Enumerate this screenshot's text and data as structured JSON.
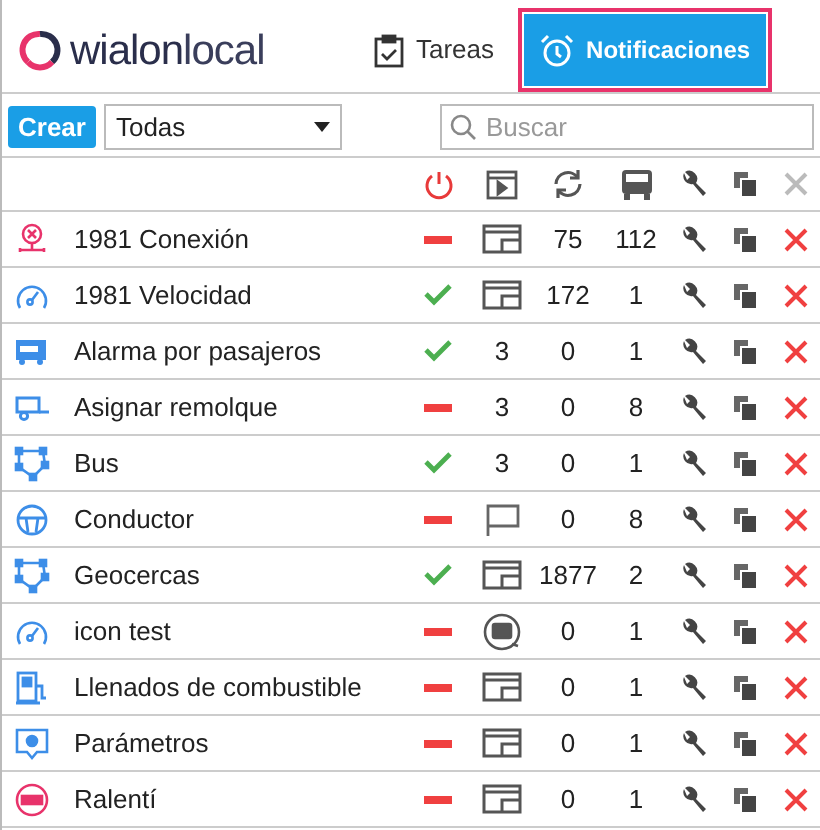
{
  "logo": {
    "part_1": "wialon",
    "part_2": "local"
  },
  "tabs": [
    {
      "label": "Tareas",
      "selected": false
    },
    {
      "label": "Notificaciones",
      "selected": true
    }
  ],
  "toolbar": {
    "create_button": "Crear",
    "filter": {
      "value": "Todas"
    },
    "search": {
      "placeholder": "Buscar"
    }
  },
  "rows": [
    {
      "name": "1981 Conexión",
      "enabled": false,
      "column_2": {
        "kind": "window"
      },
      "column_3": "75",
      "column_4": "112"
    },
    {
      "name": "1981 Velocidad",
      "enabled": true,
      "column_2": {
        "kind": "window"
      },
      "column_3": "172",
      "column_4": "1"
    },
    {
      "name": "Alarma por pasajeros",
      "enabled": true,
      "column_2": {
        "kind": "text",
        "text": "3"
      },
      "column_3": "0",
      "column_4": "1"
    },
    {
      "name": "Asignar remolque",
      "enabled": false,
      "column_2": {
        "kind": "text",
        "text": "3"
      },
      "column_3": "0",
      "column_4": "8"
    },
    {
      "name": "Bus",
      "enabled": true,
      "column_2": {
        "kind": "text",
        "text": "3"
      },
      "column_3": "0",
      "column_4": "1"
    },
    {
      "name": "Conductor",
      "enabled": false,
      "column_2": {
        "kind": "flag"
      },
      "column_3": "0",
      "column_4": "8"
    },
    {
      "name": "Geocercas",
      "enabled": true,
      "column_2": {
        "kind": "window"
      },
      "column_3": "1877",
      "column_4": "2"
    },
    {
      "name": "icon test",
      "enabled": false,
      "column_2": {
        "kind": "vehicle"
      },
      "column_3": "0",
      "column_4": "1"
    },
    {
      "name": "Llenados de combustible",
      "enabled": false,
      "column_2": {
        "kind": "window"
      },
      "column_3": "0",
      "column_4": "1"
    },
    {
      "name": "Parámetros",
      "enabled": false,
      "column_2": {
        "kind": "window"
      },
      "column_3": "0",
      "column_4": "1"
    },
    {
      "name": "Ralentí",
      "enabled": false,
      "column_2": {
        "kind": "window"
      },
      "column_3": "0",
      "column_4": "1"
    }
  ]
}
